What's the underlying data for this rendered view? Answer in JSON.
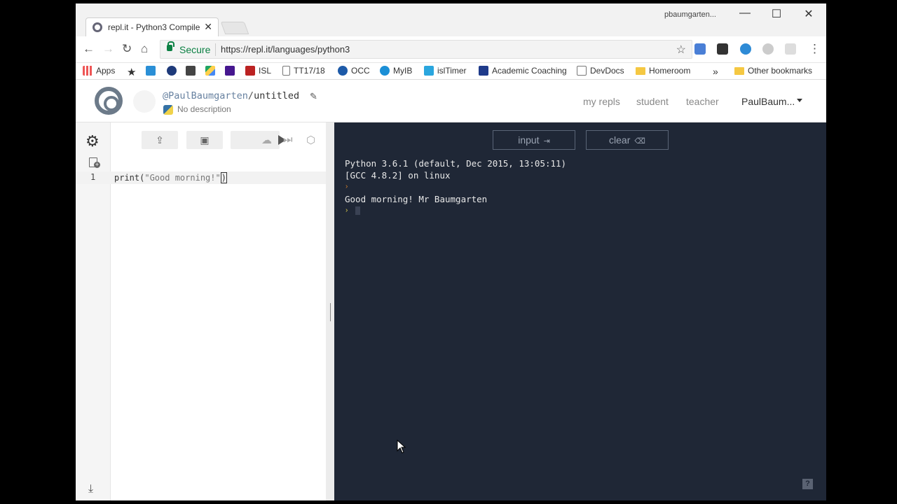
{
  "browser": {
    "tab_title": "repl.it - Python3 Compile",
    "user_name": "pbaumgarten...",
    "secure_label": "Secure",
    "url": "https://repl.it/languages/python3",
    "bookmarks": [
      {
        "label": "Apps",
        "icon": "apps-grid-icon"
      },
      {
        "label": "",
        "icon": "star-bookmark-icon"
      },
      {
        "label": "",
        "icon": "c-icon"
      },
      {
        "label": "",
        "icon": "globe-icon"
      },
      {
        "label": "",
        "icon": "contact-icon"
      },
      {
        "label": "",
        "icon": "drive-icon"
      },
      {
        "label": "",
        "icon": "kahoot-icon"
      },
      {
        "label": "ISL",
        "icon": "isl-shield-icon"
      },
      {
        "label": "TT17/18",
        "icon": "page-icon"
      },
      {
        "label": "OCC",
        "icon": "occ-icon"
      },
      {
        "label": "MyIB",
        "icon": "myib-icon"
      },
      {
        "label": "islTimer",
        "icon": "timer-icon"
      },
      {
        "label": "Academic Coaching",
        "icon": "calendar-icon"
      },
      {
        "label": "DevDocs",
        "icon": "search-doc-icon"
      },
      {
        "label": "Homeroom",
        "icon": "folder-icon"
      },
      {
        "label": "Other bookmarks",
        "icon": "folder-icon"
      }
    ],
    "overflow_label": "»"
  },
  "app": {
    "owner": "@PaulBaumgarten",
    "slash": "/",
    "repl_name": "untitled",
    "description": "No description",
    "nav": {
      "my_repls": "my repls",
      "student": "student",
      "teacher": "teacher",
      "user": "PaulBaum..."
    }
  },
  "editor": {
    "line_number": "1",
    "code_fn": "print(",
    "code_str": "\"Good morning!\"",
    "code_close": ")"
  },
  "console": {
    "input_label": "input",
    "clear_label": "clear",
    "lines": [
      "Python 3.6.1 (default, Dec 2015, 13:05:11)",
      "[GCC 4.8.2] on linux",
      "Good morning! Mr Baumgarten"
    ],
    "help_label": "?"
  },
  "colors": {
    "console_bg": "#1f2736",
    "prompt_orange": "#d9822b",
    "prompt_yellow": "#e3d34b",
    "secure_green": "#0b8043"
  }
}
